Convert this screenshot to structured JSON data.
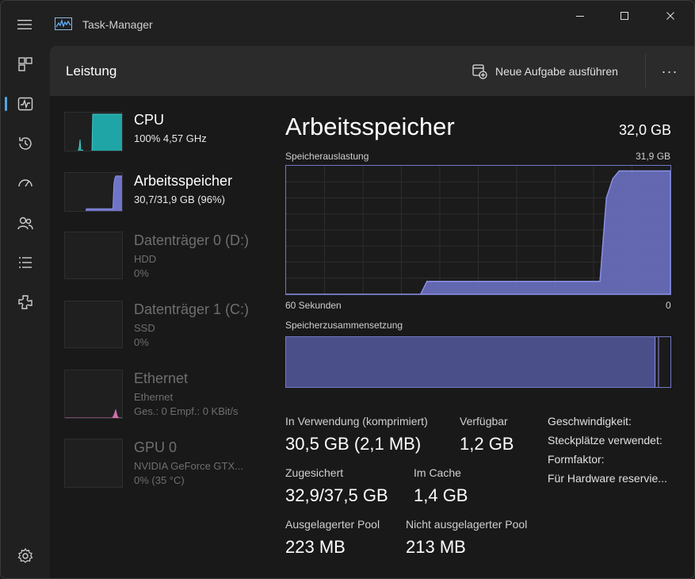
{
  "window": {
    "title": "Task-Manager"
  },
  "page": {
    "title": "Leistung",
    "new_task_label": "Neue Aufgabe ausführen",
    "more_label": "···"
  },
  "perf_items": [
    {
      "name": "CPU",
      "sub1": "100%  4,57 GHz",
      "sub2": "",
      "sub3": ""
    },
    {
      "name": "Arbeitsspeicher",
      "sub1": "30,7/31,9 GB (96%)",
      "sub2": "",
      "sub3": ""
    },
    {
      "name": "Datenträger 0 (D:)",
      "sub1": "HDD",
      "sub2": "0%",
      "sub3": ""
    },
    {
      "name": "Datenträger 1 (C:)",
      "sub1": "SSD",
      "sub2": "0%",
      "sub3": ""
    },
    {
      "name": "Ethernet",
      "sub1": "Ethernet",
      "sub2": "Ges.: 0  Empf.: 0 KBit/s",
      "sub3": ""
    },
    {
      "name": "GPU 0",
      "sub1": "NVIDIA GeForce GTX...",
      "sub2": "0%  (35 °C)",
      "sub3": ""
    }
  ],
  "memory": {
    "title": "Arbeitsspeicher",
    "total": "32,0 GB",
    "usage_label": "Speicherauslastung",
    "usage_max": "31,9 GB",
    "axis_left": "60 Sekunden",
    "axis_right": "0",
    "composition_label": "Speicherzusammensetzung",
    "composition_fractions": {
      "in_use": 0.96,
      "modified": 0.005,
      "standby": 0.03
    },
    "usage_history_fraction": [
      0,
      0,
      0,
      0,
      0,
      0,
      0,
      0,
      0,
      0,
      0,
      0,
      0,
      0,
      0,
      0,
      0,
      0,
      0,
      0,
      0,
      0,
      0.1,
      0.1,
      0.1,
      0.1,
      0.1,
      0.1,
      0.1,
      0.1,
      0.1,
      0.1,
      0.1,
      0.1,
      0.1,
      0.1,
      0.1,
      0.1,
      0.1,
      0.1,
      0.1,
      0.1,
      0.1,
      0.1,
      0.1,
      0.1,
      0.1,
      0.1,
      0.1,
      0.1,
      0.75,
      0.9,
      0.96,
      0.96,
      0.96,
      0.96,
      0.96,
      0.96,
      0.96,
      0.96,
      0.96
    ],
    "stats": [
      {
        "label": "In Verwendung (komprimiert)",
        "value": "30,5 GB (2,1 MB)"
      },
      {
        "label": "Verfügbar",
        "value": "1,2 GB"
      },
      {
        "label": "Zugesichert",
        "value": "32,9/37,5 GB"
      },
      {
        "label": "Im Cache",
        "value": "1,4 GB"
      },
      {
        "label": "Ausgelagerter Pool",
        "value": "223 MB"
      },
      {
        "label": "Nicht ausgelagerter Pool",
        "value": "213 MB"
      }
    ],
    "details": [
      "Geschwindigkeit:",
      "Steckplätze verwendet:",
      "Formfaktor:",
      "Für Hardware reservie..."
    ]
  },
  "colors": {
    "memory_fill": "#6f74c9",
    "memory_line": "#8a90e6",
    "cpu_fill": "#1fa5a5",
    "ethernet_line": "#d06fae",
    "accent": "#4fa6e8"
  }
}
